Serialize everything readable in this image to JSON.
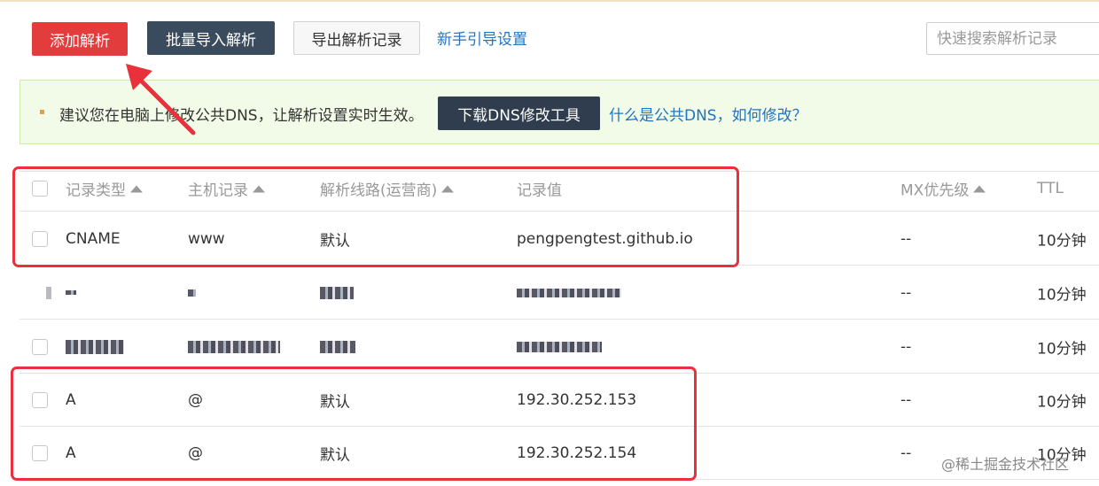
{
  "toolbar": {
    "add_label": "添加解析",
    "batch_label": "批量导入解析",
    "export_label": "导出解析记录",
    "guide_link": "新手引导设置",
    "search_placeholder": "快速搜索解析记录"
  },
  "notice": {
    "text": "建议您在电脑上修改公共DNS，让解析设置实时生效。",
    "download_label": "下载DNS修改工具",
    "help_link": "什么是公共DNS，如何修改？"
  },
  "table": {
    "headers": {
      "type": "记录类型",
      "host": "主机记录",
      "line": "解析线路(运营商)",
      "value": "记录值",
      "mx": "MX优先级",
      "ttl": "TTL"
    },
    "rows": [
      {
        "type": "CNAME",
        "host": "www",
        "line": "默认",
        "value": "pengpengtest.github.io",
        "mx": "--",
        "ttl": "10分钟"
      },
      {
        "type": "",
        "host": "",
        "line": "",
        "value": "",
        "mx": "--",
        "ttl": "10分钟"
      },
      {
        "type": "",
        "host": "",
        "line": "",
        "value": "",
        "mx": "--",
        "ttl": "10分钟"
      },
      {
        "type": "A",
        "host": "@",
        "line": "默认",
        "value": "192.30.252.153",
        "mx": "--",
        "ttl": "10分钟"
      },
      {
        "type": "A",
        "host": "@",
        "line": "默认",
        "value": "192.30.252.154",
        "mx": "--",
        "ttl": "10分钟"
      }
    ]
  },
  "watermark": "@稀土掘金技术社区",
  "colors": {
    "primary_red": "#e33c3c",
    "dark_button": "#3b4b5e",
    "link_blue": "#1f74c4",
    "annotation_red": "#e8313b",
    "notice_bg": "#f2fbe7"
  }
}
